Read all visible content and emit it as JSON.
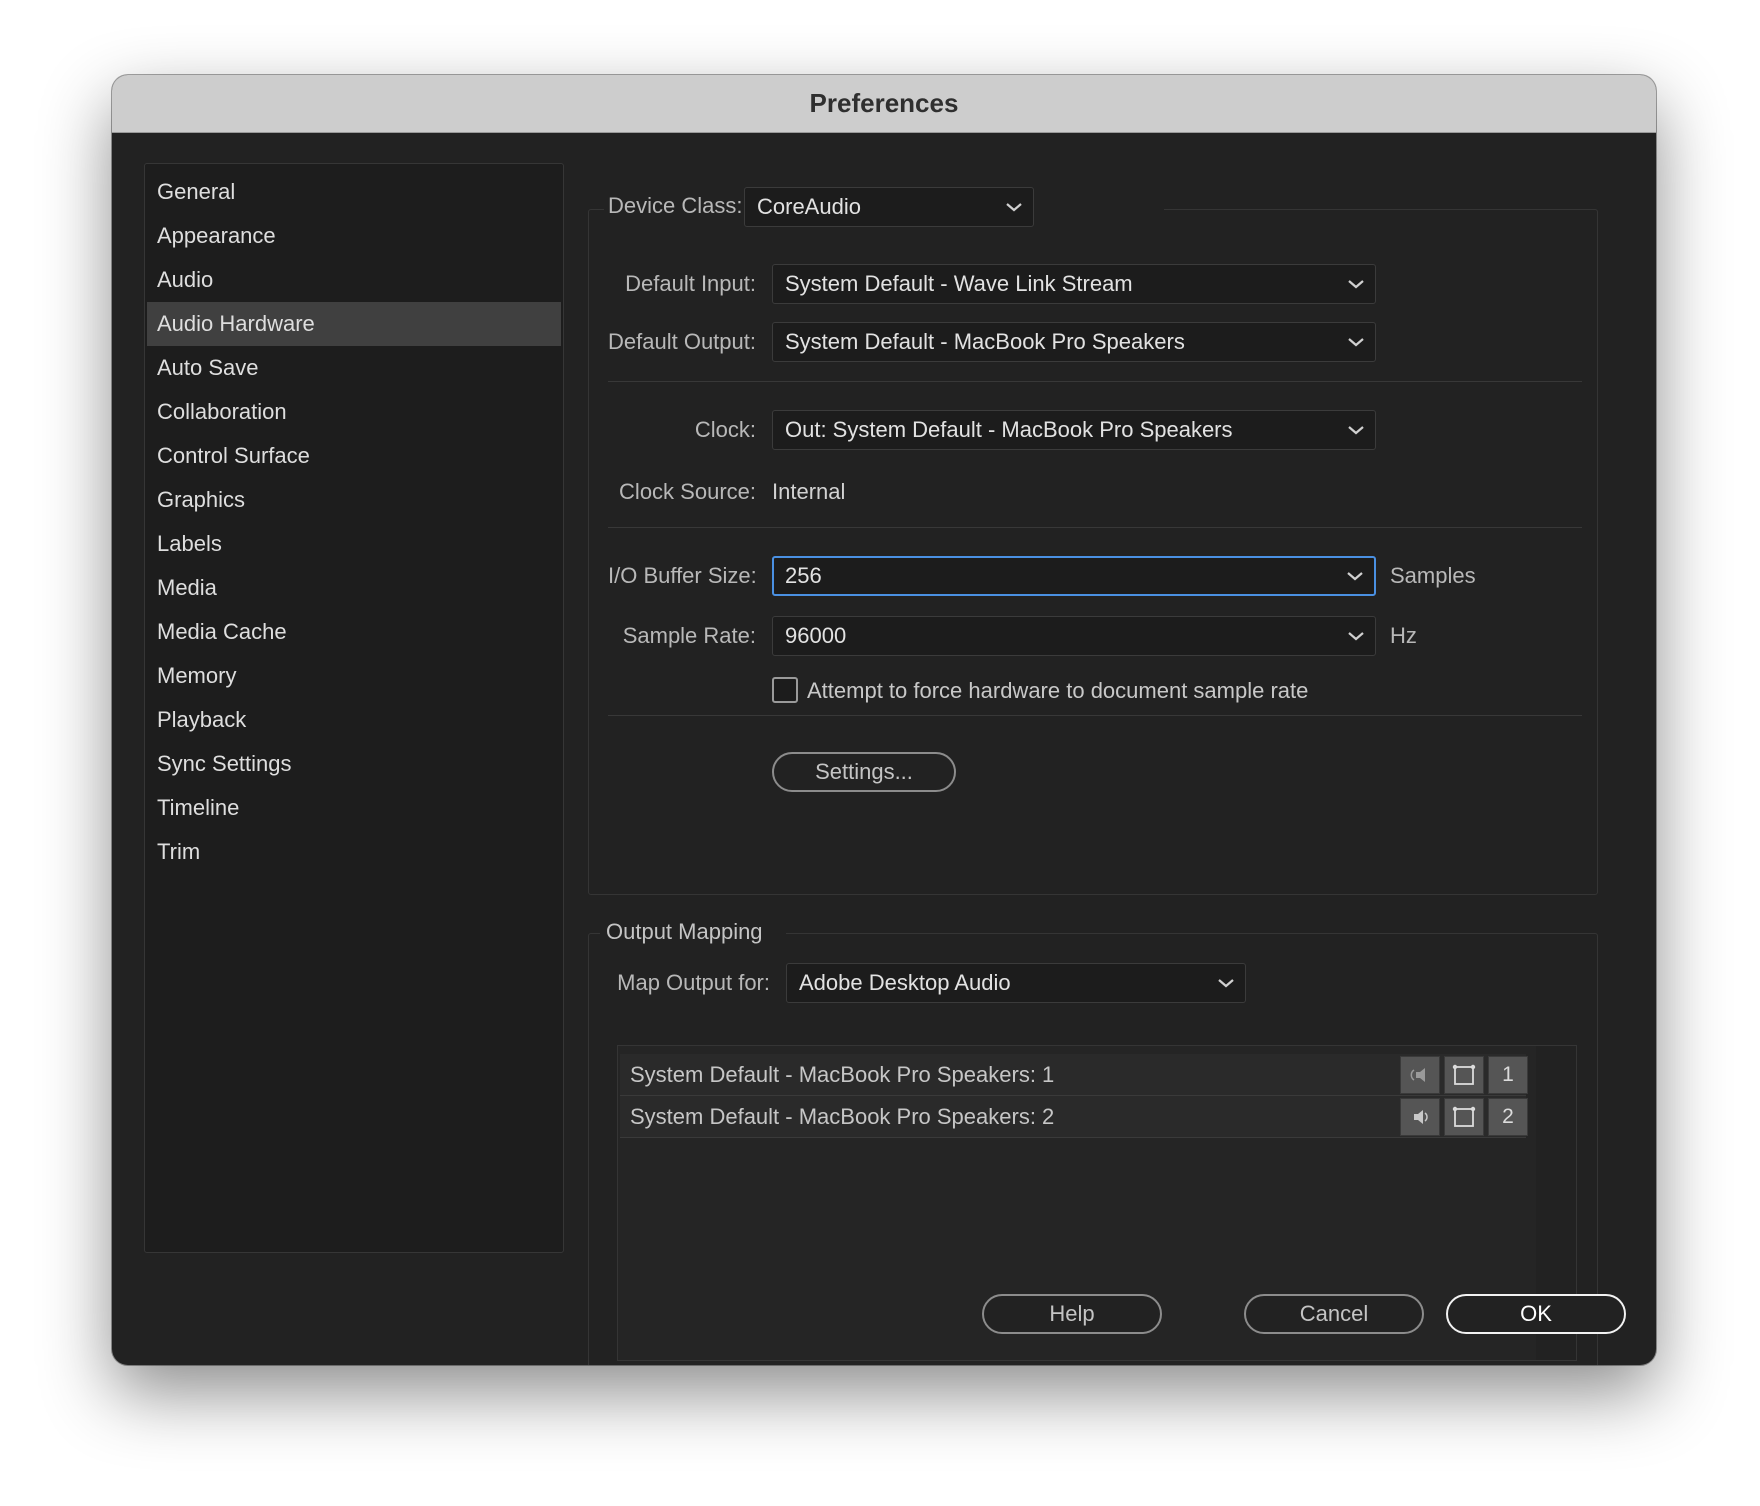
{
  "window": {
    "title": "Preferences"
  },
  "sidebar": {
    "items": [
      {
        "label": "General"
      },
      {
        "label": "Appearance"
      },
      {
        "label": "Audio"
      },
      {
        "label": "Audio Hardware",
        "selected": true
      },
      {
        "label": "Auto Save"
      },
      {
        "label": "Collaboration"
      },
      {
        "label": "Control Surface"
      },
      {
        "label": "Graphics"
      },
      {
        "label": "Labels"
      },
      {
        "label": "Media"
      },
      {
        "label": "Media Cache"
      },
      {
        "label": "Memory"
      },
      {
        "label": "Playback"
      },
      {
        "label": "Sync Settings"
      },
      {
        "label": "Timeline"
      },
      {
        "label": "Trim"
      }
    ]
  },
  "hardware": {
    "device_class": {
      "label": "Device Class:",
      "value": "CoreAudio"
    },
    "default_input": {
      "label": "Default Input:",
      "value": "System Default - Wave Link Stream"
    },
    "default_output": {
      "label": "Default Output:",
      "value": "System Default - MacBook Pro Speakers"
    },
    "clock": {
      "label": "Clock:",
      "value": "Out: System Default - MacBook Pro Speakers"
    },
    "clock_source": {
      "label": "Clock Source:",
      "value": "Internal"
    },
    "buffer_size": {
      "label": "I/O Buffer Size:",
      "value": "256",
      "unit": "Samples"
    },
    "sample_rate": {
      "label": "Sample Rate:",
      "value": "96000",
      "unit": "Hz"
    },
    "force_rate": {
      "label": "Attempt to force hardware to document sample rate",
      "checked": false
    },
    "settings_button": "Settings..."
  },
  "output_mapping": {
    "title": "Output Mapping",
    "map_for": {
      "label": "Map Output for:",
      "value": "Adobe Desktop Audio"
    },
    "rows": [
      {
        "label": "System Default - MacBook Pro Speakers: 1",
        "channel": "1",
        "icon": "speaker-left-icon"
      },
      {
        "label": "System Default - MacBook Pro Speakers: 2",
        "channel": "2",
        "icon": "speaker-right-icon"
      }
    ]
  },
  "footer": {
    "help": "Help",
    "cancel": "Cancel",
    "ok": "OK"
  },
  "colors": {
    "accent_focus": "#4a90e2",
    "window_bg": "#222222",
    "titlebar_bg": "#cdcdcd",
    "selected_bg": "#404040"
  }
}
